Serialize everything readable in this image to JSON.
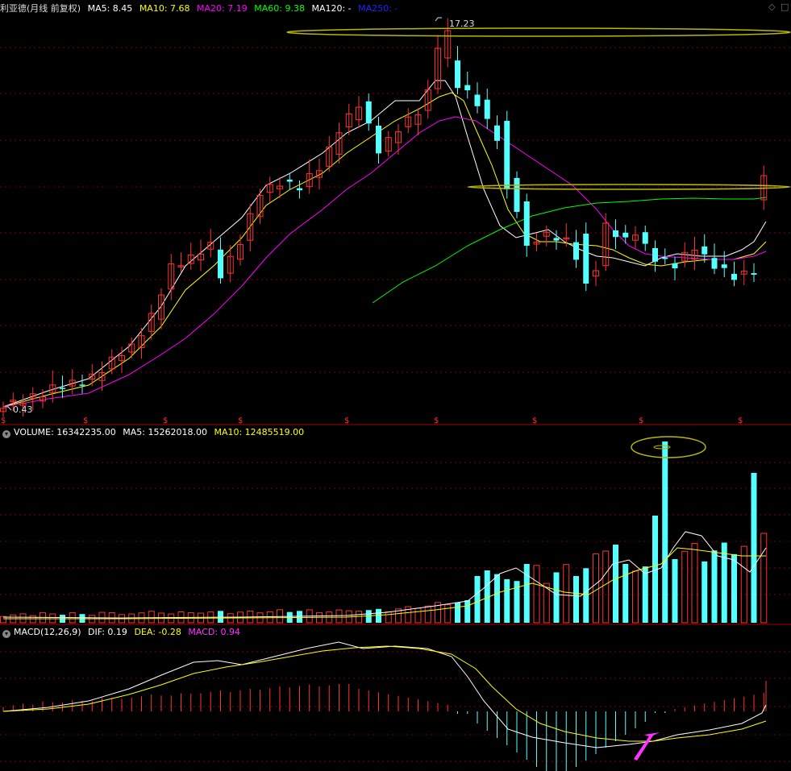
{
  "colors": {
    "up": "#ff3232",
    "down": "#54ffff",
    "ma5": "#ffffff",
    "ma10": "#ffff00",
    "ma20": "#ff00ff",
    "ma60": "#00ff00",
    "ma120": "#ffffff",
    "ma250": "#0000ff",
    "grid": "#7a0000",
    "text": "#dddddd",
    "highlight": "#b8b800",
    "arrow": "#ff33ff"
  },
  "price_panel": {
    "title": "利亚德(月线 前复权)",
    "ma5_label": "MA5: 8.45",
    "ma10_label": "MA10: 7.68",
    "ma20_label": "MA20: 7.19",
    "ma60_label": "MA60: 9.38",
    "ma120_label": "MA120: -",
    "ma250_label": "MA250: -",
    "high_label": "17.23",
    "low_label": "0.43",
    "marker_symbol": "$"
  },
  "volume_panel": {
    "volume_label": "VOLUME: 16342235.00",
    "ma5_label": "MA5: 15262018.00",
    "ma10_label": "MA10: 12485519.00"
  },
  "macd_panel": {
    "title_label": "MACD(12,26,9)",
    "dif_label": "DIF: 0.19",
    "dea_label": "DEA: -0.28",
    "macd_label": "MACD: 0.94"
  },
  "corner_icons": [
    "diamond-icon",
    "square-icon"
  ],
  "chart_data": [
    {
      "type": "candlestick",
      "title": "利亚德(月线 前复权)",
      "annotations": [
        "17.23",
        "0.43"
      ],
      "series": [
        {
          "name": "MA5",
          "values": [
            8.45
          ]
        },
        {
          "name": "MA10",
          "values": [
            7.68
          ]
        },
        {
          "name": "MA20",
          "values": [
            7.19
          ]
        },
        {
          "name": "MA60",
          "values": [
            9.38
          ]
        },
        {
          "name": "MA120",
          "values": []
        },
        {
          "name": "MA250",
          "values": []
        }
      ]
    },
    {
      "type": "bar",
      "title": "VOLUME",
      "series": [
        {
          "name": "VOLUME",
          "values": [
            16342235.0
          ]
        },
        {
          "name": "MA5",
          "values": [
            15262018.0
          ]
        },
        {
          "name": "MA10",
          "values": [
            12485519.0
          ]
        }
      ]
    },
    {
      "type": "bar",
      "title": "MACD(12,26,9)",
      "series": [
        {
          "name": "DIF",
          "values": [
            0.19
          ]
        },
        {
          "name": "DEA",
          "values": [
            -0.28
          ]
        },
        {
          "name": "MACD",
          "values": [
            0.94
          ]
        }
      ]
    }
  ]
}
